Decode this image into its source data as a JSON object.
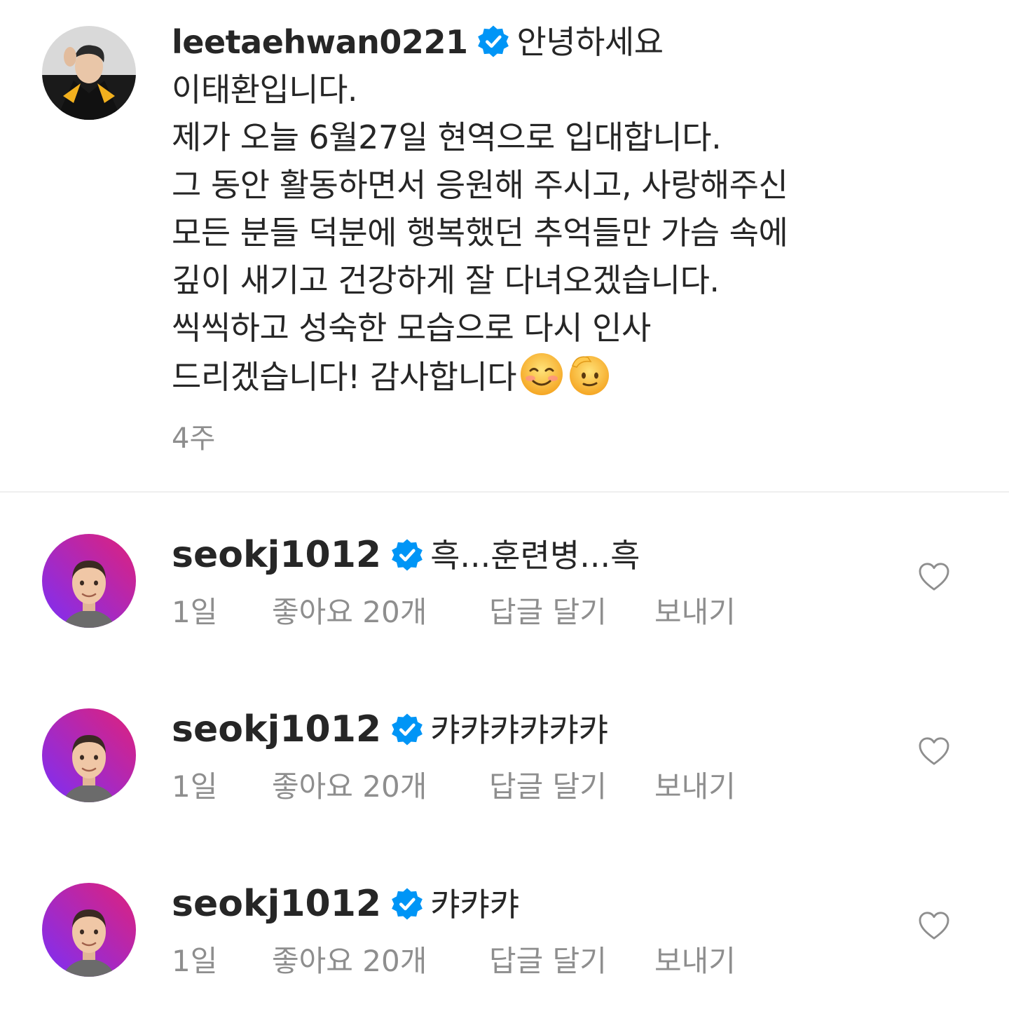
{
  "caption": {
    "username": "leetaehwan0221",
    "lines": [
      "안녕하세요",
      "이태환입니다.",
      "제가 오늘 6월27일 현역으로 입대합니다.",
      "그 동안 활동하면서 응원해 주시고, 사랑해주신",
      "모든 분들 덕분에 행복했던 추억들만 가슴 속에",
      "깊이 새기고 건강하게 잘 다녀오겠습니다.",
      "씩씩하고 성숙한 모습으로 다시 인사",
      "드리겠습니다! 감사합니다"
    ],
    "emojis": [
      "smiling-blush-emoji",
      "saluting-face-emoji"
    ],
    "time": "4주"
  },
  "comments": [
    {
      "username": "seokj1012",
      "text": "흑...훈련병...흑",
      "time": "1일",
      "likes": "좋아요 20개",
      "reply": "답글 달기",
      "send": "보내기"
    },
    {
      "username": "seokj1012",
      "text": "캬캬캬캬캬캬",
      "time": "1일",
      "likes": "좋아요 20개",
      "reply": "답글 달기",
      "send": "보내기"
    },
    {
      "username": "seokj1012",
      "text": "캬캬캬",
      "time": "1일",
      "likes": "좋아요 20개",
      "reply": "답글 달기",
      "send": "보내기"
    }
  ],
  "colors": {
    "text": "#262626",
    "secondary": "#8e8e8e",
    "verified": "#0095f6",
    "avatar_gradient_start": "#e0217a",
    "avatar_gradient_end": "#7b2ff7"
  }
}
